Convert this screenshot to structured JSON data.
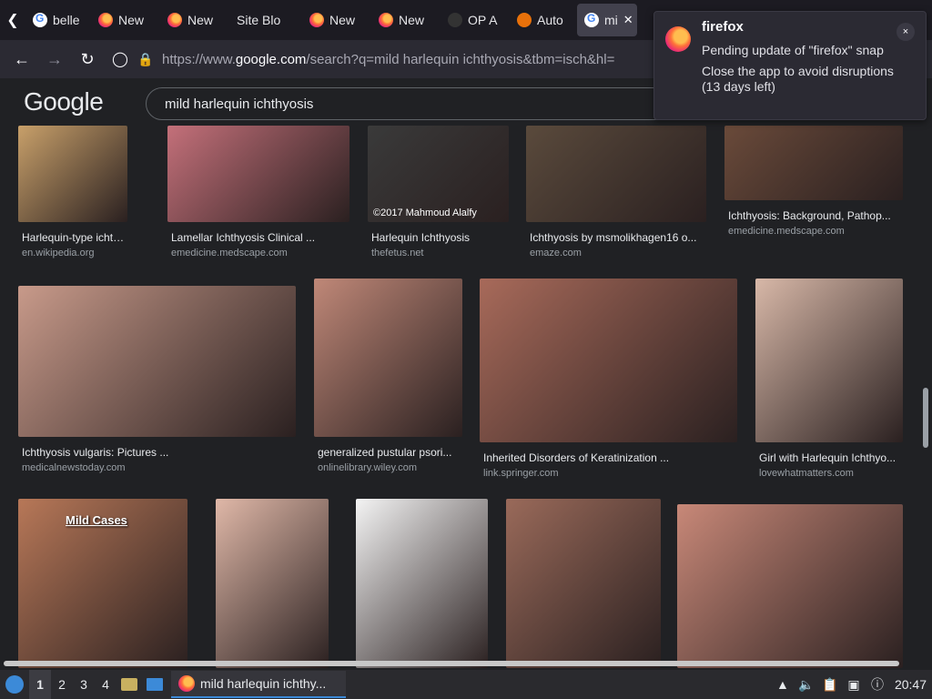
{
  "tabs": [
    {
      "label": "belle",
      "icon": "google-icon"
    },
    {
      "label": "New",
      "icon": "firefox-icon"
    },
    {
      "label": "New",
      "icon": "firefox-icon"
    },
    {
      "label": "Site Blo",
      "icon": ""
    },
    {
      "label": "New",
      "icon": "firefox-icon"
    },
    {
      "label": "New",
      "icon": "firefox-icon"
    },
    {
      "label": "OP A",
      "icon": "op-icon"
    },
    {
      "label": "Auto",
      "icon": "auto-icon"
    },
    {
      "label": "mi",
      "icon": "google-icon",
      "active": true
    }
  ],
  "url": {
    "prefix": "https://www.",
    "host": "google.com",
    "path": "/search?q=mild harlequin ichthyosis&tbm=isch&hl="
  },
  "google": {
    "logo": "Google",
    "query": "mild harlequin ichthyosis"
  },
  "notification": {
    "app": "firefox",
    "line1": "Pending update of \"firefox\" snap",
    "line2": "Close the app to avoid disruptions (13 days left)",
    "close": "×"
  },
  "results_row1": [
    {
      "caption": "Harlequin-type ichthyo...",
      "source": "en.wikipedia.org",
      "color": "#c8a06a"
    },
    {
      "caption": "Lamellar Ichthyosis Clinical ...",
      "source": "emedicine.medscape.com",
      "color": "#c4707a"
    },
    {
      "caption": "Harlequin Ichthyosis",
      "source": "thefetus.net",
      "color": "#3a3a3a",
      "watermark": "©2017 Mahmoud Alalfy"
    },
    {
      "caption": "Ichthyosis by msmolikhagen16 o...",
      "source": "emaze.com",
      "color": "#5a4a3c"
    },
    {
      "caption": "Ichthyosis: Background, Pathop...",
      "source": "emedicine.medscape.com",
      "color": "#6a4a3a"
    }
  ],
  "results_row2": [
    {
      "caption": "Ichthyosis vulgaris: Pictures ...",
      "source": "medicalnewstoday.com",
      "color": "#c89a8a"
    },
    {
      "caption": "generalized pustular psori...",
      "source": "onlinelibrary.wiley.com",
      "color": "#c08878"
    },
    {
      "caption": "Inherited Disorders of Keratinization ...",
      "source": "link.springer.com",
      "color": "#a86a5a"
    },
    {
      "caption": "Girl with Harlequin Ichthyo...",
      "source": "lovewhatmatters.com",
      "color": "#d8b8a8"
    }
  ],
  "results_row3": [
    {
      "label": "Mild Cases",
      "color": "#b87858"
    },
    {
      "color": "#e0b8a8"
    },
    {
      "color": "#f4f4f4"
    },
    {
      "color": "#9a6a5a"
    },
    {
      "color": "#c88878"
    }
  ],
  "taskbar": {
    "workspaces": [
      "1",
      "2",
      "3",
      "4"
    ],
    "window_title": "mild harlequin ichthy...",
    "clock": "20:47"
  }
}
